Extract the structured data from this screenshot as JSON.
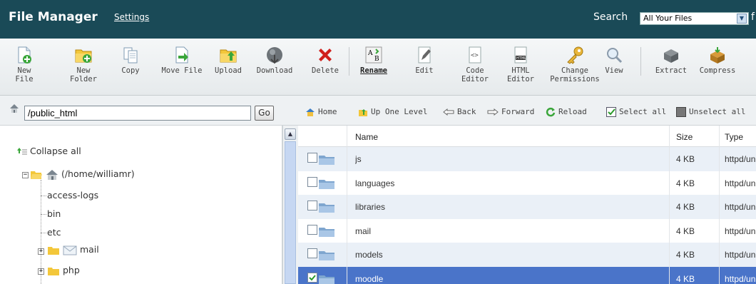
{
  "header": {
    "title": "File Manager",
    "settings": "Settings",
    "search_label": "Search",
    "search_scope": "All Your Files",
    "search_tail": "f"
  },
  "toolbar": [
    {
      "name": "new-file",
      "label": "New File"
    },
    {
      "name": "new-folder",
      "label1": "New",
      "label2": "Folder"
    },
    {
      "name": "copy",
      "label": "Copy"
    },
    {
      "name": "move-file",
      "label": "Move File"
    },
    {
      "name": "upload",
      "label": "Upload"
    },
    {
      "name": "download",
      "label": "Download"
    },
    {
      "name": "delete",
      "label": "Delete"
    },
    {
      "name": "rename",
      "label": "Rename"
    },
    {
      "name": "edit",
      "label": "Edit"
    },
    {
      "name": "code-editor",
      "label1": "Code",
      "label2": "Editor"
    },
    {
      "name": "html-editor",
      "label1": "HTML",
      "label2": "Editor"
    },
    {
      "name": "change-permissions",
      "label1": "Change",
      "label2": "Permissions"
    },
    {
      "name": "view",
      "label": "View"
    },
    {
      "name": "extract",
      "label": "Extract"
    },
    {
      "name": "compress",
      "label": "Compress"
    }
  ],
  "path": {
    "value": "/public_html",
    "go": "Go"
  },
  "nav": {
    "home": "Home",
    "up": "Up One Level",
    "back": "Back",
    "forward": "Forward",
    "reload": "Reload",
    "select_all": "Select all",
    "unselect_all": "Unselect all"
  },
  "tree": {
    "collapse_all": "Collapse all",
    "root": "(/home/williamr)",
    "items": [
      "access-logs",
      "bin",
      "etc",
      "mail",
      "php"
    ]
  },
  "table": {
    "columns": [
      "Name",
      "Size",
      "Type"
    ],
    "rows": [
      {
        "name": "js",
        "size": "4 KB",
        "type": "httpd/unix-directory",
        "selected": false
      },
      {
        "name": "languages",
        "size": "4 KB",
        "type": "httpd/unix-directory",
        "selected": false
      },
      {
        "name": "libraries",
        "size": "4 KB",
        "type": "httpd/unix-directory",
        "selected": false
      },
      {
        "name": "mail",
        "size": "4 KB",
        "type": "httpd/unix-directory",
        "selected": false
      },
      {
        "name": "models",
        "size": "4 KB",
        "type": "httpd/unix-directory",
        "selected": false
      },
      {
        "name": "moodle",
        "size": "4 KB",
        "type": "httpd/unix-directory",
        "selected": true
      }
    ]
  },
  "colors": {
    "header_bg": "#1a4a57",
    "row_alt": "#eaf0f7",
    "row_selected": "#4a74c9"
  }
}
